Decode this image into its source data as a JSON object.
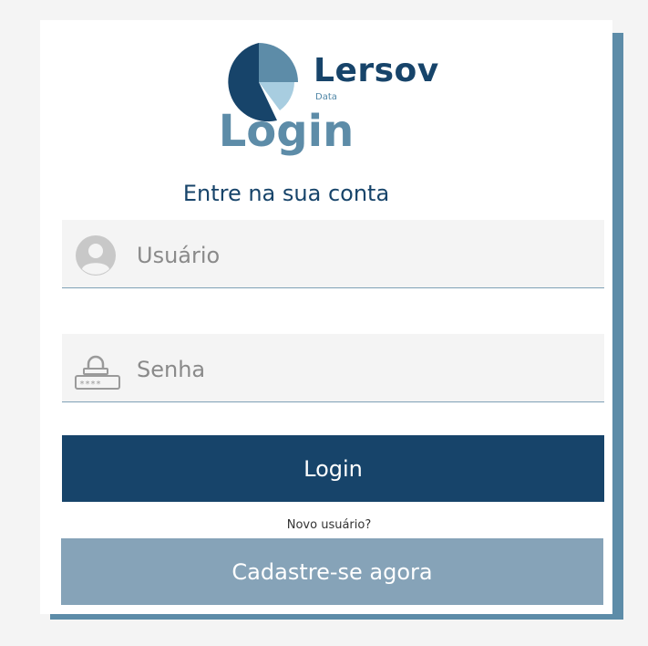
{
  "brand": {
    "name": "Lersov",
    "sub": "Data"
  },
  "login": {
    "title": "Login",
    "subtitle": "Entre na sua conta",
    "username_placeholder": "Usuário",
    "password_placeholder": "Senha",
    "login_button": "Login",
    "new_user_text": "Novo usuário?",
    "signup_button": "Cadastre-se agora"
  },
  "icons": {
    "logo": "pie-chart-icon",
    "user": "user-avatar-icon",
    "password": "lock-password-icon"
  },
  "colors": {
    "primary": "#17446a",
    "accent": "#5d8ca8",
    "secondary_button": "#86a3b8",
    "light": "#a8cde0",
    "field_bg": "#f4f4f4"
  }
}
